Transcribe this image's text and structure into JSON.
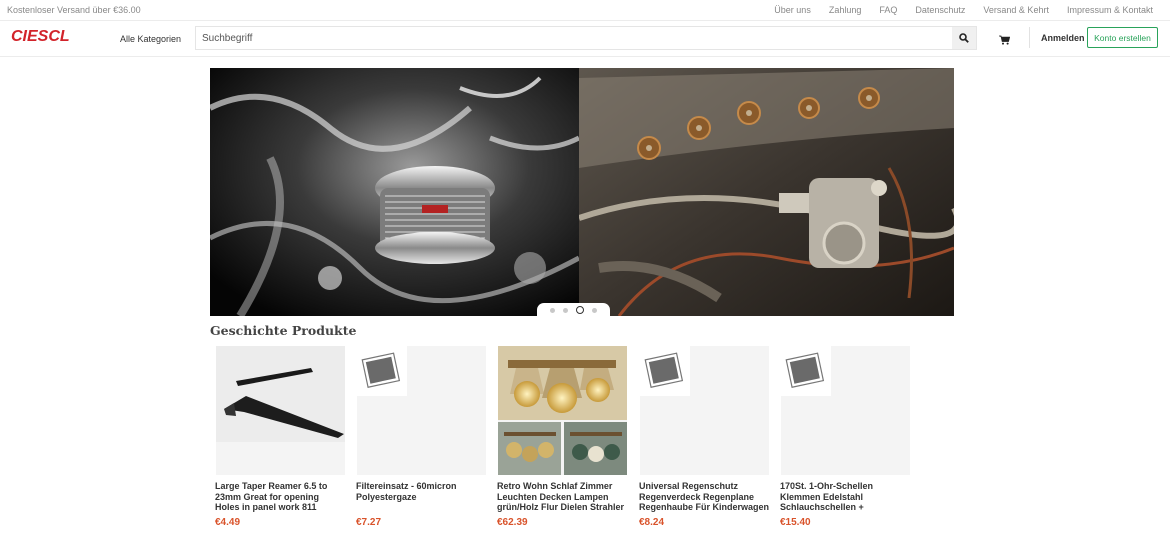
{
  "topbar": {
    "promo": "Kostenloser Versand über €36.00",
    "links": [
      "Über uns",
      "Zahlung",
      "FAQ",
      "Datenschutz",
      "Versand & Kehrt",
      "Impressum & Kontakt"
    ]
  },
  "header": {
    "logo": "CIESCL",
    "categories": "Alle Kategorien",
    "search_placeholder": "Suchbegriff",
    "login": "Anmelden",
    "register": "Konto erstellen"
  },
  "icons": {
    "search": "search-icon",
    "cart": "cart-icon"
  },
  "carousel": {
    "slides": 4,
    "active_index": 2
  },
  "section": {
    "title": "Geschichte Produkte"
  },
  "products": [
    {
      "name": "Large Taper Reamer 6.5 to 23mm Great for opening Holes in panel work 811",
      "price": "€4.49",
      "image": "reamer"
    },
    {
      "name": "Filtereinsatz - 60micron Polyestergaze",
      "price": "€7.27",
      "image": "placeholder"
    },
    {
      "name": "Retro Wohn Schlaf Zimmer Leuchten Decken Lampen grün/Holz Flur Dielen Strahler",
      "price": "€62.39",
      "image": "lamps"
    },
    {
      "name": "Universal Regenschutz Regenverdeck Regenplane Regenhaube Für Kinderwagen",
      "price": "€8.24",
      "image": "placeholder"
    },
    {
      "name": "170St. 1-Ohr-Schellen Klemmen Edelstahl Schlauchschellen +",
      "price": "€15.40",
      "image": "placeholder"
    }
  ],
  "colors": {
    "brand": "#d2232a",
    "accent": "#29a35a",
    "price": "#d9532b"
  }
}
